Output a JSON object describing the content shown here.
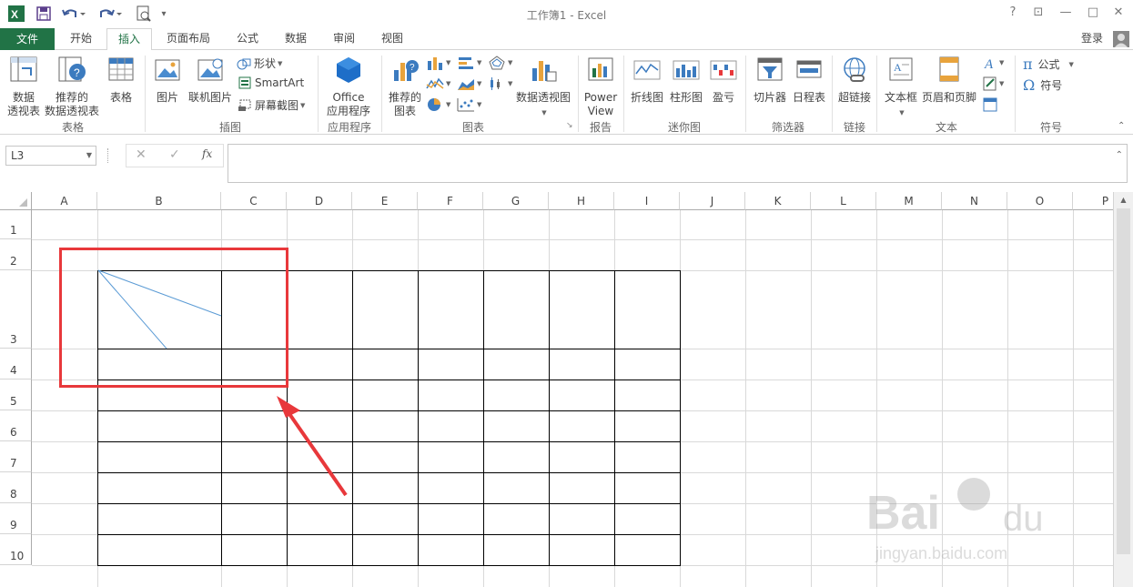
{
  "window": {
    "title": "工作簿1 - Excel",
    "help": "?",
    "restore_ribbon": "⊡",
    "minimize": "—",
    "maximize": "□",
    "close": "✕"
  },
  "tabs": [
    "文件",
    "开始",
    "插入",
    "页面布局",
    "公式",
    "数据",
    "审阅",
    "视图"
  ],
  "login": "登录",
  "ribbon": {
    "pivot_table": "数据\n透视表",
    "recommended_pivot": "推荐的\n数据透视表",
    "table": "表格",
    "picture": "图片",
    "online_picture": "联机图片",
    "shapes": "形状",
    "smartart": "SmartArt",
    "screenshot": "屏幕截图",
    "office_apps": "Office\n应用程序",
    "recommended_charts": "推荐的\n图表",
    "pivot_chart": "数据透视图",
    "power_view": "Power\nView",
    "line_spark": "折线图",
    "column_spark": "柱形图",
    "winloss_spark": "盈亏",
    "slicer": "切片器",
    "timeline": "日程表",
    "hyperlink": "超链接",
    "textbox": "文本框",
    "header_footer": "页眉和页脚",
    "equation": "公式",
    "symbol": "符号",
    "groups": {
      "tables": "表格",
      "illustrations": "插图",
      "apps": "应用程序",
      "charts": "图表",
      "reports": "报告",
      "sparklines": "迷你图",
      "filters": "筛选器",
      "links": "链接",
      "text": "文本",
      "symbols": "符号"
    }
  },
  "formula_bar": {
    "name_box": "L3",
    "cancel": "✕",
    "enter": "✓",
    "fx": "fx",
    "content": ""
  },
  "columns": [
    "A",
    "B",
    "C",
    "D",
    "E",
    "F",
    "G",
    "H",
    "I",
    "J",
    "K",
    "L",
    "M",
    "N",
    "O",
    "P"
  ],
  "rows": [
    "1",
    "2",
    "3",
    "4",
    "5",
    "6",
    "7",
    "8",
    "9",
    "10"
  ],
  "colors": {
    "excel_green": "#217346",
    "highlight_red": "#e8383b",
    "diagonal_line": "#5b9bd5"
  }
}
